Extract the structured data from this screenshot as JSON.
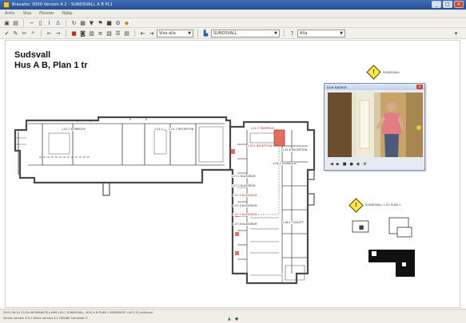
{
  "window": {
    "title": "Bravatec 3000 Version 4.2 - SUNDSVALL A B PL1",
    "controls": {
      "minimize": "_",
      "maximize": "□",
      "close": "×"
    }
  },
  "menubar": {
    "items": [
      "Arkiv",
      "Visa",
      "Fönster",
      "Hjälp"
    ]
  },
  "toolbar2": {
    "view_combo": "Visa alla",
    "location_combo": "SUNDSVALL",
    "filter_combo": "Alla"
  },
  "canvas": {
    "title_line1": "Sudsvall",
    "title_line2": "Hus A B, Plan 1 tr",
    "room_labels": [
      "1.02.1 TRAPPHUS",
      "1.02.7 KORRIDOR",
      "1.02.2",
      "1.01.7 RECEPTION",
      "1.02.8 RECEPTION",
      "1.06.1 RECEPTION",
      "1.06.2 KORRIDOR",
      "1.07.1 KLASSRUM",
      "1.07.2 KLASSRUM",
      "1.07.3 KLASSRUM",
      "1.07.4 KLASSRUM",
      "1.07.5 KLASSRUM",
      "1.07.6 KLASSRUM",
      "1.08.1 TOALETT"
    ],
    "alarm_top_label": "SUNDSVALL",
    "alarm_bottom_label": "SUNDSVALL 1.02 PLAN 1"
  },
  "camera_window": {
    "title": "Live kamera",
    "controls": [
      "◀",
      "▶",
      "■",
      "●",
      "◉",
      "⚙"
    ]
  },
  "statusbar": {
    "line1": "2007-06-14 13:24:08 BRÄNDTILLARM L03-7 SUNDSVALL, HUS A B PLAN 1 KORRIDOR 1.06.2 Ej kvitterad",
    "line2": "Server version 3.0.1 Klient version 4.2   ONLINE Larmlista 3"
  },
  "colors": {
    "titlebar": "#2a579a",
    "alarm_room": "#e07060",
    "warning": "#ffe54a"
  }
}
